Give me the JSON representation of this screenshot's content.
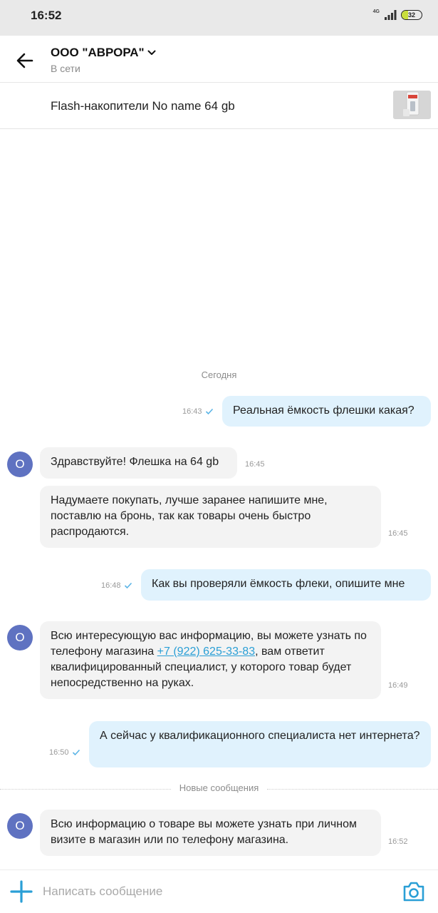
{
  "status_bar": {
    "time": "16:52",
    "network": "4G",
    "battery": "32",
    "battery_level": 0.32
  },
  "header": {
    "title": "ООО \"АВРОРА\"",
    "subtitle": "В сети"
  },
  "product": {
    "title": "Flash-накопители No name 64 gb"
  },
  "date_separator": "Сегодня",
  "messages": [
    {
      "direction": "out",
      "text": "Реальная ёмкость флешки какая?",
      "time": "16:43"
    },
    {
      "direction": "in",
      "avatar": "O",
      "text": "Здравствуйте! Флешка на 64 gb",
      "time": "16:45"
    },
    {
      "direction": "in",
      "text": "Надумаете покупать, лучше заранее напишите мне, поставлю на бронь, так как товары очень быстро распродаются.",
      "time": "16:45"
    },
    {
      "direction": "out",
      "text": "Как вы проверяли ёмкость флеки, опишите мне",
      "time": "16:48"
    },
    {
      "direction": "in",
      "avatar": "O",
      "text_before": "Всю интересующую вас информацию, вы можете узнать по телефону магазина ",
      "phone": "+7 (922) 625-33-83",
      "text_after": ", вам ответит квалифицированный специалист, у которого товар будет непосредственно на руках.",
      "time": "16:49"
    },
    {
      "direction": "out",
      "text": "А сейчас у квалификационного специалиста нет интернета?",
      "time": "16:50"
    },
    {
      "direction": "in",
      "avatar": "O",
      "text": "Всю информацию о товаре вы можете узнать при личном визите в магазин или по телефону магазина.",
      "time": "16:52"
    }
  ],
  "new_messages_separator": "Новые сообщения",
  "composer": {
    "placeholder": "Написать сообщение"
  },
  "colors": {
    "accent": "#2a9fd6",
    "outgoing_bubble": "#e0f2fd",
    "incoming_bubble": "#f3f3f3",
    "avatar": "#5f72c1",
    "read_check": "#5ab4e6"
  },
  "icons": [
    "back-arrow-icon",
    "chevron-down-icon",
    "check-icon",
    "plus-icon",
    "camera-icon",
    "signal-icon",
    "battery-icon"
  ]
}
